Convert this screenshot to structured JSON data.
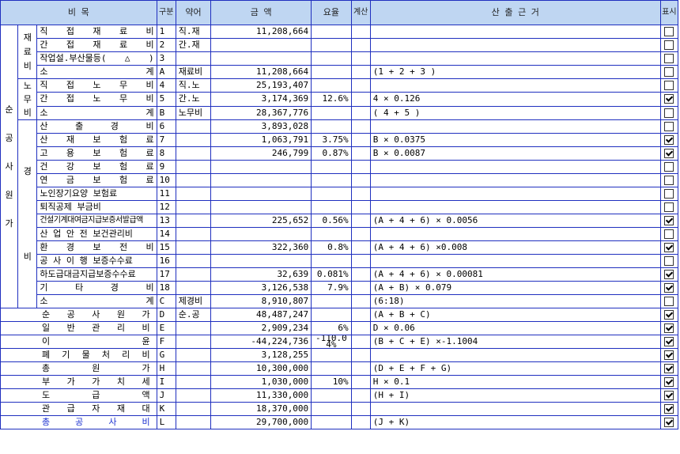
{
  "header": {
    "item": "비                목",
    "gubun": "구분",
    "abbr": "약어",
    "amount": "금       액",
    "rate": "요율",
    "calc": "계산",
    "basis": "산  출  근  거",
    "show": "표시"
  },
  "groups": {
    "main": "순\n\n공\n\n사\n\n원\n\n가",
    "material": "재\n료\n비",
    "labor": "노\n무\n비",
    "expense": "경\n\n\n\n\n\n\n\n\n비"
  },
  "rows": [
    {
      "label": "직  접  재  료  비",
      "code": "1",
      "abbr": "직.재",
      "amount": "11,208,664",
      "rate": "",
      "basis": "",
      "checked": false
    },
    {
      "label": "간  접  재  료  비",
      "code": "2",
      "abbr": "간.재",
      "amount": "",
      "rate": "",
      "basis": "",
      "checked": false
    },
    {
      "label": "작업설.부산물등(△)",
      "code": "3",
      "abbr": "",
      "amount": "",
      "rate": "",
      "basis": "",
      "checked": false
    },
    {
      "label": "소                계",
      "code": "A",
      "abbr": "재료비",
      "amount": "11,208,664",
      "rate": "",
      "basis": "(1 + 2 + 3 )",
      "checked": false
    },
    {
      "label": "직  접  노  무  비",
      "code": "4",
      "abbr": "직.노",
      "amount": "25,193,407",
      "rate": "",
      "basis": "",
      "checked": false
    },
    {
      "label": "간  접  노  무  비",
      "code": "5",
      "abbr": "간.노",
      "amount": "3,174,369",
      "rate": "12.6%",
      "basis": "4 × 0.126",
      "checked": true
    },
    {
      "label": "소                계",
      "code": "B",
      "abbr": "노무비",
      "amount": "28,367,776",
      "rate": "",
      "basis": "( 4 + 5 )",
      "checked": false
    },
    {
      "label": "산    출    경    비",
      "code": "6",
      "abbr": "",
      "amount": "3,893,028",
      "rate": "",
      "basis": "",
      "checked": false
    },
    {
      "label": "산  재  보  험  료",
      "code": "7",
      "abbr": "",
      "amount": "1,063,791",
      "rate": "3.75%",
      "basis": "B × 0.0375",
      "checked": true
    },
    {
      "label": "고  용  보  험  료",
      "code": "8",
      "abbr": "",
      "amount": "246,799",
      "rate": "0.87%",
      "basis": "B × 0.0087",
      "checked": true
    },
    {
      "label": "건  강  보  험  료",
      "code": "9",
      "abbr": "",
      "amount": "",
      "rate": "",
      "basis": "",
      "checked": false
    },
    {
      "label": "연  금  보  험  료",
      "code": "10",
      "abbr": "",
      "amount": "",
      "rate": "",
      "basis": "",
      "checked": false
    },
    {
      "label": "노인장기요양 보험료",
      "code": "11",
      "abbr": "",
      "amount": "",
      "rate": "",
      "basis": "",
      "checked": false
    },
    {
      "label": "퇴직공제 부금비",
      "code": "12",
      "abbr": "",
      "amount": "",
      "rate": "",
      "basis": "",
      "checked": false
    },
    {
      "label": "건설기계대여금지급보증서발급액",
      "code": "13",
      "abbr": "",
      "amount": "225,652",
      "rate": "0.56%",
      "basis": "(A + 4 + 6) × 0.0056",
      "checked": true
    },
    {
      "label": "산 업 안 전 보건관리비",
      "code": "14",
      "abbr": "",
      "amount": "",
      "rate": "",
      "basis": "",
      "checked": false
    },
    {
      "label": "환  경  보  전  비",
      "code": "15",
      "abbr": "",
      "amount": "322,360",
      "rate": "0.8%",
      "basis": "(A + 4 + 6) ×0.008",
      "checked": true
    },
    {
      "label": "공 사 이 행 보증수수료",
      "code": "16",
      "abbr": "",
      "amount": "",
      "rate": "",
      "basis": "",
      "checked": false
    },
    {
      "label": "하도급대금지급보증수수료",
      "code": "17",
      "abbr": "",
      "amount": "32,639",
      "rate": "0.081%",
      "basis": "(A + 4 + 6) × 0.00081",
      "checked": true
    },
    {
      "label": "기      타      경      비",
      "code": "18",
      "abbr": "",
      "amount": "3,126,538",
      "rate": "7.9%",
      "basis": "(A + B) × 0.079",
      "checked": true
    },
    {
      "label": "소                계",
      "code": "C",
      "abbr": "제경비",
      "amount": "8,910,807",
      "rate": "",
      "basis": "(6:18)",
      "checked": false
    },
    {
      "label": "순  공  사  원  가",
      "code": "D",
      "abbr": "순.공",
      "amount": "48,487,247",
      "rate": "",
      "basis": "(A + B + C)",
      "checked": true
    },
    {
      "label": "일  반  관  리  비",
      "code": "E",
      "abbr": "",
      "amount": "2,909,234",
      "rate": "6%",
      "basis": "D × 0.06",
      "checked": true
    },
    {
      "label": "이                윤",
      "code": "F",
      "abbr": "",
      "amount": "-44,224,736",
      "rate": "-110.04%",
      "basis": "(B + C + E)  ×-1.1004",
      "checked": true
    },
    {
      "label": "폐  기  물  처  리  비",
      "code": "G",
      "abbr": "",
      "amount": "3,128,255",
      "rate": "",
      "basis": "",
      "checked": true
    },
    {
      "label": "총          원          가",
      "code": "H",
      "abbr": "",
      "amount": "10,300,000",
      "rate": "",
      "basis": "(D + E + F + G)",
      "checked": true
    },
    {
      "label": "부   가   가   치   세",
      "code": "I",
      "abbr": "",
      "amount": "1,030,000",
      "rate": "10%",
      "basis": "H × 0.1",
      "checked": true
    },
    {
      "label": "도          급          액",
      "code": "J",
      "abbr": "",
      "amount": "11,330,000",
      "rate": "",
      "basis": "(H + I)",
      "checked": true
    },
    {
      "label": "관  급  자  재  대",
      "code": "K",
      "abbr": "",
      "amount": "18,370,000",
      "rate": "",
      "basis": "",
      "checked": true
    },
    {
      "label": "총      공      사      비",
      "code": "L",
      "abbr": "",
      "amount": "29,700,000",
      "rate": "",
      "basis": "(J + K)",
      "checked": true
    }
  ]
}
